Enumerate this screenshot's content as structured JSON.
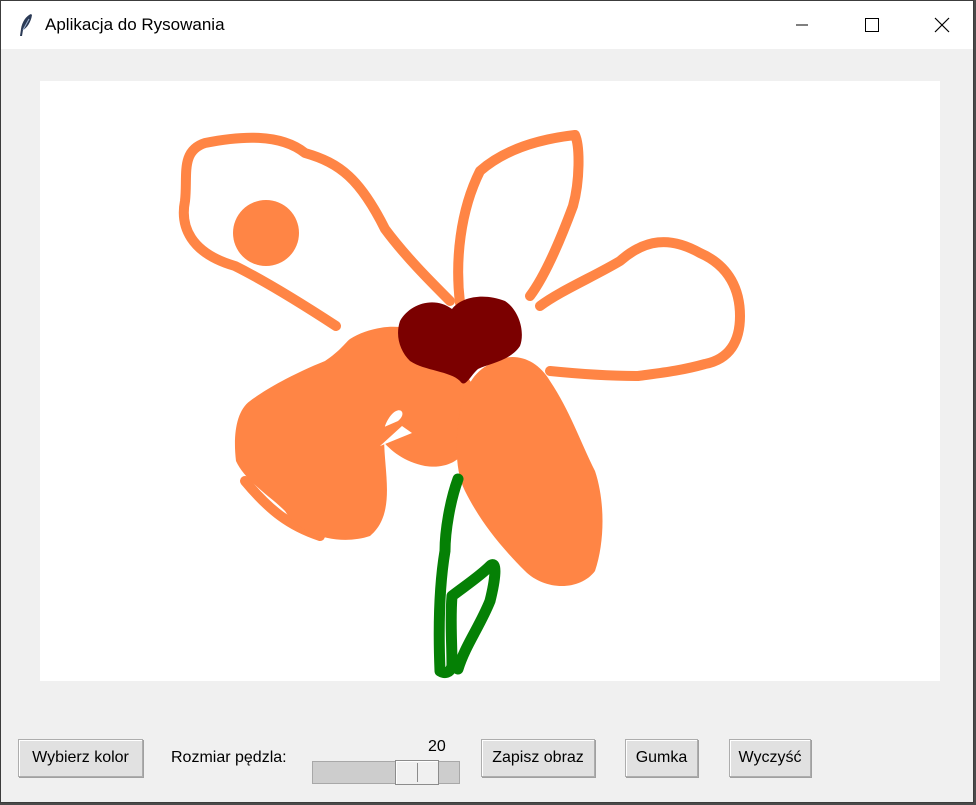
{
  "window": {
    "title": "Aplikacja do Rysowania",
    "icon": "feather-icon",
    "controls": [
      "minimize-icon",
      "maximize-icon",
      "close-icon"
    ]
  },
  "canvas": {
    "background": "#ffffff",
    "drawing": {
      "petal_color": "#ff8545",
      "center_color": "#7b0000",
      "stem_color": "#058005"
    }
  },
  "toolbar": {
    "choose_color_label": "Wybierz kolor",
    "brush_size_label": "Rozmiar pędzla:",
    "brush_size_value": "20",
    "brush_size_fraction": 0.8,
    "save_label": "Zapisz obraz",
    "eraser_label": "Gumka",
    "clear_label": "Wyczyść"
  }
}
